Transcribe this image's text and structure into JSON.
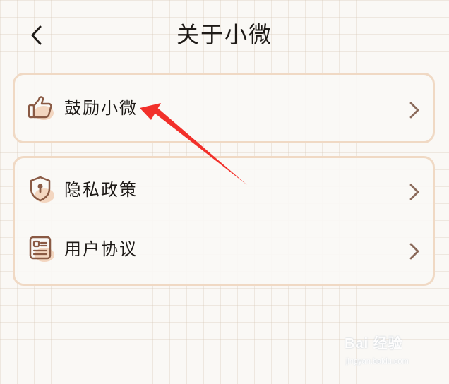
{
  "header": {
    "title": "关于小微",
    "back_icon": "chevron-left-icon"
  },
  "groups": [
    {
      "items": [
        {
          "label": "鼓励小微",
          "icon": "thumbs-up-icon"
        }
      ]
    },
    {
      "items": [
        {
          "label": "隐私政策",
          "icon": "shield-keyhole-icon"
        },
        {
          "label": "用户协议",
          "icon": "id-card-icon"
        }
      ]
    }
  ],
  "colors": {
    "background": "#faf8f5",
    "card_border": "#f0d9c4",
    "icon_stroke": "#8a5a44",
    "icon_fill": "#f3d6c0",
    "chevron": "#8a6a5a",
    "annotation": "#f2302a"
  },
  "watermark": {
    "logo": "Bai 经验",
    "site": "jingyan.baidu.com"
  }
}
